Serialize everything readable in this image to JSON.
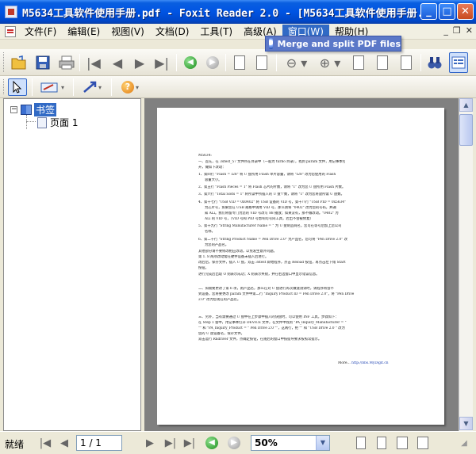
{
  "window": {
    "title": "M5634工具软件使用手册.pdf - Foxit Reader 2.0 - [M5634工具软件使用手册.",
    "minimize": "_",
    "maximize": "□",
    "close": "✕"
  },
  "menu": {
    "items": [
      {
        "label": "文件(F)"
      },
      {
        "label": "编辑(E)"
      },
      {
        "label": "视图(V)"
      },
      {
        "label": "文档(D)"
      },
      {
        "label": "工具(T)"
      },
      {
        "label": "高级(A)"
      },
      {
        "label": "窗口(W)"
      },
      {
        "label": "帮助(H)"
      }
    ],
    "mdi_minimize": "_",
    "mdi_restore": "❐",
    "mdi_close": "✕",
    "dropdown_item": "Merge and split PDF files"
  },
  "sidebar": {
    "root_label": "书签",
    "child_label": "页面 1",
    "expander": "−"
  },
  "document": {
    "lines": [
      "M5634:",
      "一、首先，在 3stest_57 文件所在目录中（一般为 turbo 目录），找到 param 文件，用记事本打",
      "开，做如下改动：",
      "1、第四行 \"Flash = I28\" 将 U 盘所用 Flash 单片容量，请将 \"I28\" 改为您使用的 Flash",
      "容量大小。",
      "2、第五行 \"Flash Pieces = 1\" 将 Flash 芯片的片数，请将 \"1\" 改为您 U 盘所用 Flash 片数。",
      "3、第六行 \"Total Slots = 1\" 将所读中所插入的 U 盘个数，请将 \"1\" 改为您将放所需 U 盘数。",
      "4、第十七行 \"USB VID = 0x0402\" 将 USB 设备的 VID 号，第十八行 \"USB PID = 0x5634\"",
      "为芯片号，如果您在 USB 规格中请用 VID 号，那么请将 \"0402\" 改为您的号码，并通",
      "知 ALi。我们将留专门为您的 VID 号改写 88 播放；如果没有，那不做改动。\"0402\" 为",
      "ALi 的 VID 号，（VID 号和 PID 号影响可号同工具，若出不会被修复）",
      "5、第十九行 \"String Manufacturer Name = \" 为 U 盘制造商名，您可在等号后加上您公司",
      "名称。",
      "6、第二十行 \"String Product Name = Pen Drive 2.0\" 为产品名，您可将 \"Pen Drive 2.0\" 改",
      "为您的产品名。",
      "其他部分请不要修改相应改动，以免发生意外问题。",
      "第 1. 8 两项改动需在硬件设备未插入后进行。",
      "改后后，保存文件，插入 U 盘，双击 3stest 即始程序，点击 Reload 按钮，再点击左下角 Start",
      "按钮。",
      "进行完成后出现 O 则表示成功；X 则表示失败，并在右边窗口中显示错误信息。",
      "",
      "二、如需要更改了第 6 项，则产品名，那么在对 U 盘进行再次做速测试时，请程序将会不",
      "到设备，您将要更改 param 文件中第二行 \"Inquiry Product ID = Pen Drive 2.0\"，将 \"Pen Drive",
      "2.0\" 改为您现在的产品名。",
      "",
      "三、另外，当有需要通过 U 盘中在上步骤中插入的快盘时，可以使用 INF 工具，步骤如下：",
      "在 Step 1 窗中，用记事本打开 DEVICE 文件，在文件中找到 \"PA_Inquiry_Manufacturer = \"",
      "\"\" 和 \"PA_Inquiry_Product = \" Pen Drive 2.0 \"\"，这两行，把 \"\" 和 \"USB Drive 2.0 \" 改为",
      "您的 U 盘设备名，保存文件。",
      "双击运行 Rndriver 文件，点确定按钮，在随后的窗口中按提导要求按照常提示。"
    ],
    "footer_text": "More...",
    "footer_link": "http://bbs.MyDigit.cn"
  },
  "statusbar": {
    "status": "就绪",
    "page_value": "1 / 1",
    "zoom_value": "50%",
    "zoom_drop": "▼"
  }
}
